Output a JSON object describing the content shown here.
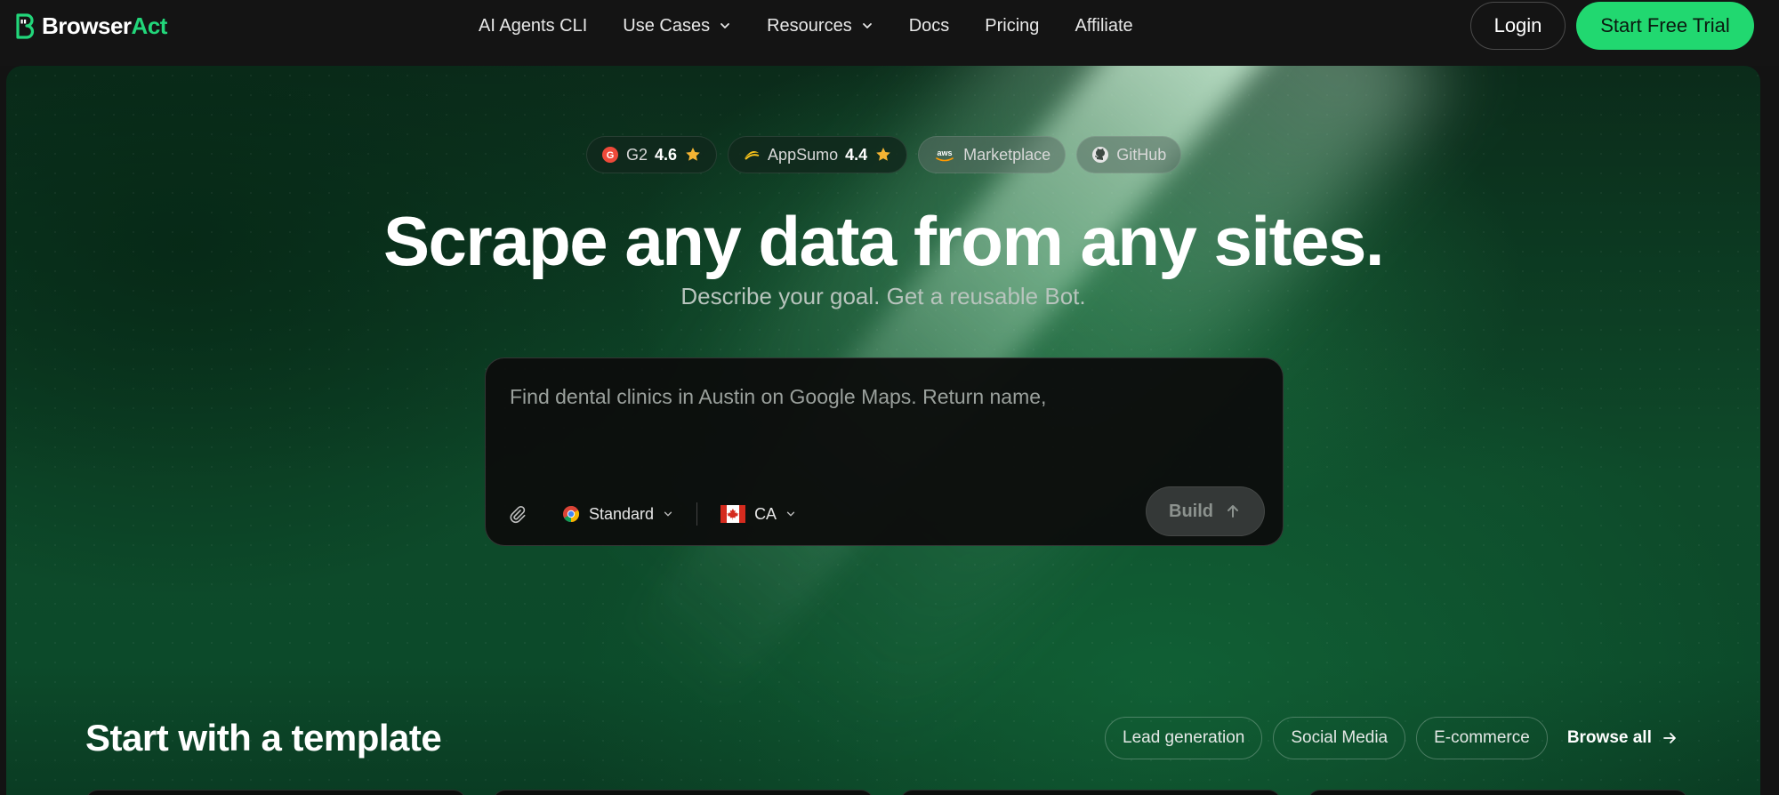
{
  "nav": {
    "logo_part1": "Browser",
    "logo_part2": "Act",
    "links": [
      {
        "label": "AI Agents CLI",
        "dropdown": false
      },
      {
        "label": "Use Cases",
        "dropdown": true
      },
      {
        "label": "Resources",
        "dropdown": true
      },
      {
        "label": "Docs",
        "dropdown": false
      },
      {
        "label": "Pricing",
        "dropdown": false
      },
      {
        "label": "Affiliate",
        "dropdown": false
      }
    ],
    "login_label": "Login",
    "trial_label": "Start Free Trial"
  },
  "badges": [
    {
      "name": "G2",
      "rating": "4.6",
      "icon": "g2-icon",
      "star": true
    },
    {
      "name": "AppSumo",
      "rating": "4.4",
      "icon": "appsumo-icon",
      "star": true
    },
    {
      "name": "Marketplace",
      "rating": "",
      "icon": "aws-icon",
      "star": false
    },
    {
      "name": "GitHub",
      "rating": "",
      "icon": "github-icon",
      "star": false
    }
  ],
  "hero": {
    "title": "Scrape any data from any sites.",
    "subtitle": "Describe your goal. Get a reusable Bot."
  },
  "prompt": {
    "placeholder": "Find dental clinics in Austin on Google Maps. Return name,",
    "browser_mode": "Standard",
    "country": "CA",
    "build_label": "Build"
  },
  "templates": {
    "title": "Start with a template",
    "chips": [
      "Lead generation",
      "Social Media",
      "E-commerce"
    ],
    "browse_label": "Browse all"
  },
  "colors": {
    "accent": "#21d870",
    "background": "#141414",
    "hero_green": "#0e4a2a"
  }
}
